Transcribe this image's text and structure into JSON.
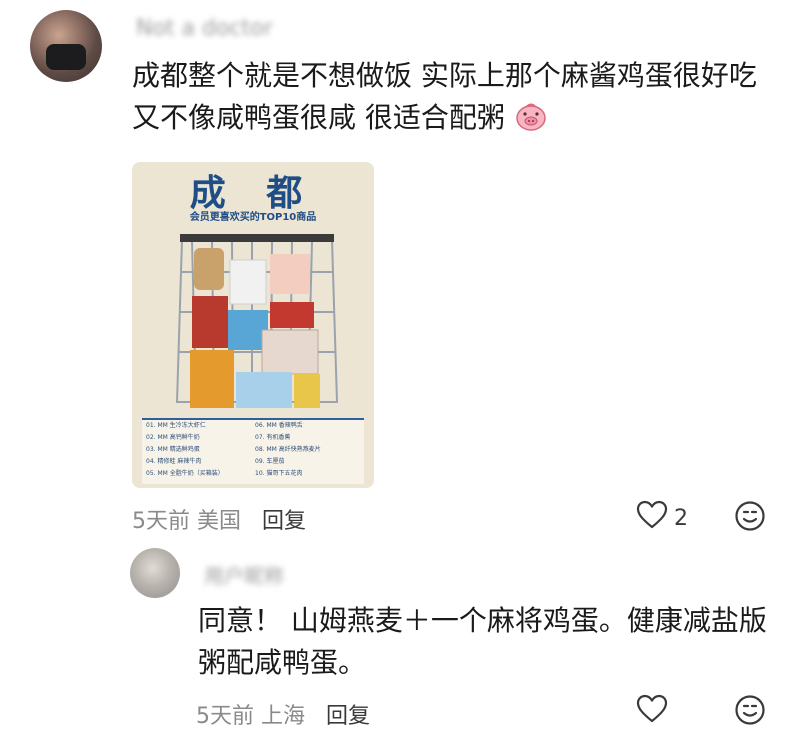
{
  "comment_1": {
    "username": "Not a doctor",
    "text_line1": "成都整个就是不想做饭 实际上那个麻酱鸡蛋很好吃",
    "text_line2": "又不像咸鸭蛋很咸 很适合配粥",
    "emoji": "pig-face-emoji",
    "time_location": "5天前 美国",
    "reply_label": "回复",
    "like_count": "2",
    "image": {
      "title": "成 都",
      "subtitle": "会员更喜欢买的TOP10商品",
      "list": [
        [
          "01. MM 生冷冻大虾仁",
          "06. MM 香辣鸭舌"
        ],
        [
          "02. MM 高钙鲜牛奶",
          "07. 有机香蕉"
        ],
        [
          "03. MM 精选鲜鸡蛋",
          "08. MM 高纤快熟燕麦片"
        ],
        [
          "04. 精修蛙 麻辣牛肉",
          "09. 车厘茄"
        ],
        [
          "05. MM 全脂牛奶（买箱装）",
          "10. 猫哥下五花肉"
        ]
      ]
    }
  },
  "comment_2": {
    "username": "用户昵称",
    "text_line1": "同意！ 山姆燕麦＋一个麻将鸡蛋。健康减盐版",
    "text_line2": "粥配咸鸭蛋。",
    "time_location": "5天前 上海",
    "reply_label": "回复",
    "like_count": ""
  },
  "colors": {
    "text": "#1a1a1a",
    "meta": "#8a8a8a",
    "poster_blue": "#1f4d86",
    "poster_bg": "#ece5d3"
  },
  "icons": [
    "heart-icon",
    "smile-face-icon",
    "pig-face-emoji"
  ]
}
